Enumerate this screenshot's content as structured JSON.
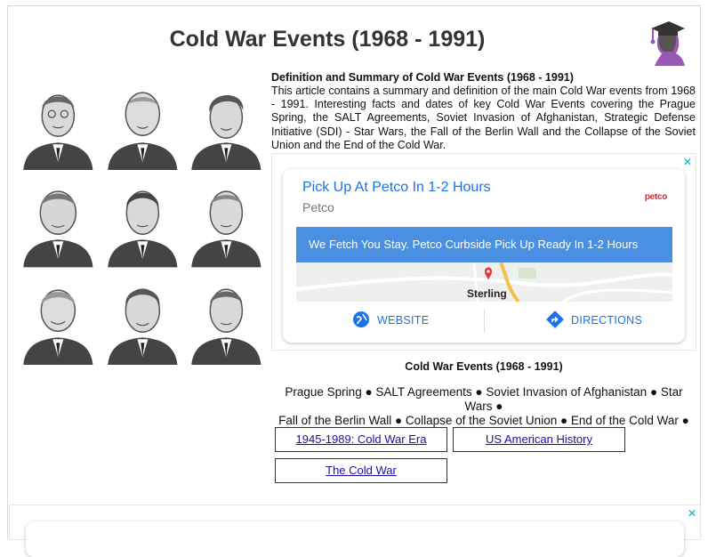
{
  "page": {
    "title": "Cold War Events (1968 - 1991)"
  },
  "logo": {
    "icon": "graduate-silhouette-icon",
    "color": "#9b59b6"
  },
  "article": {
    "heading": "Definition and Summary of Cold War Events (1968 - 1991)",
    "body": "This article contains a summary and definition of the main Cold War events from 1968 - 1991. Interesting facts and dates of key Cold War Events covering the Prague Spring, the SALT Agreements, Soviet Invasion of Afghanistan, Strategic Defense Initiative (SDI) - Star Wars, the Fall of the Berlin Wall and the Collapse of the Soviet Union and the End of the Cold War."
  },
  "ad": {
    "close_glyph": "✕",
    "headline": "Pick Up At Petco In 1-2 Hours",
    "advertiser": "Petco",
    "brand_logo": "petco",
    "banner": "We Fetch You Stay. Petco Curbside Pick Up Ready In 1-2 Hours",
    "map_label": "Sterling",
    "website_label": "WEBSITE",
    "directions_label": "DIRECTIONS",
    "accent_color": "#1a73e8",
    "banner_color": "#4a90e2"
  },
  "events_section": {
    "title": "Cold War Events (1968 - 1991)",
    "line1": "Prague Spring ● SALT Agreements ● Soviet Invasion of Afghanistan ● Star Wars ●",
    "line2": "Fall of the Berlin Wall ● Collapse of the Soviet Union ● End of the Cold War ●"
  },
  "links": {
    "cold_war_era": "1945-1989: Cold War Era",
    "us_history": "US American History",
    "the_cold_war": "The Cold War"
  },
  "bottom_ad": {
    "close_glyph": "✕"
  }
}
